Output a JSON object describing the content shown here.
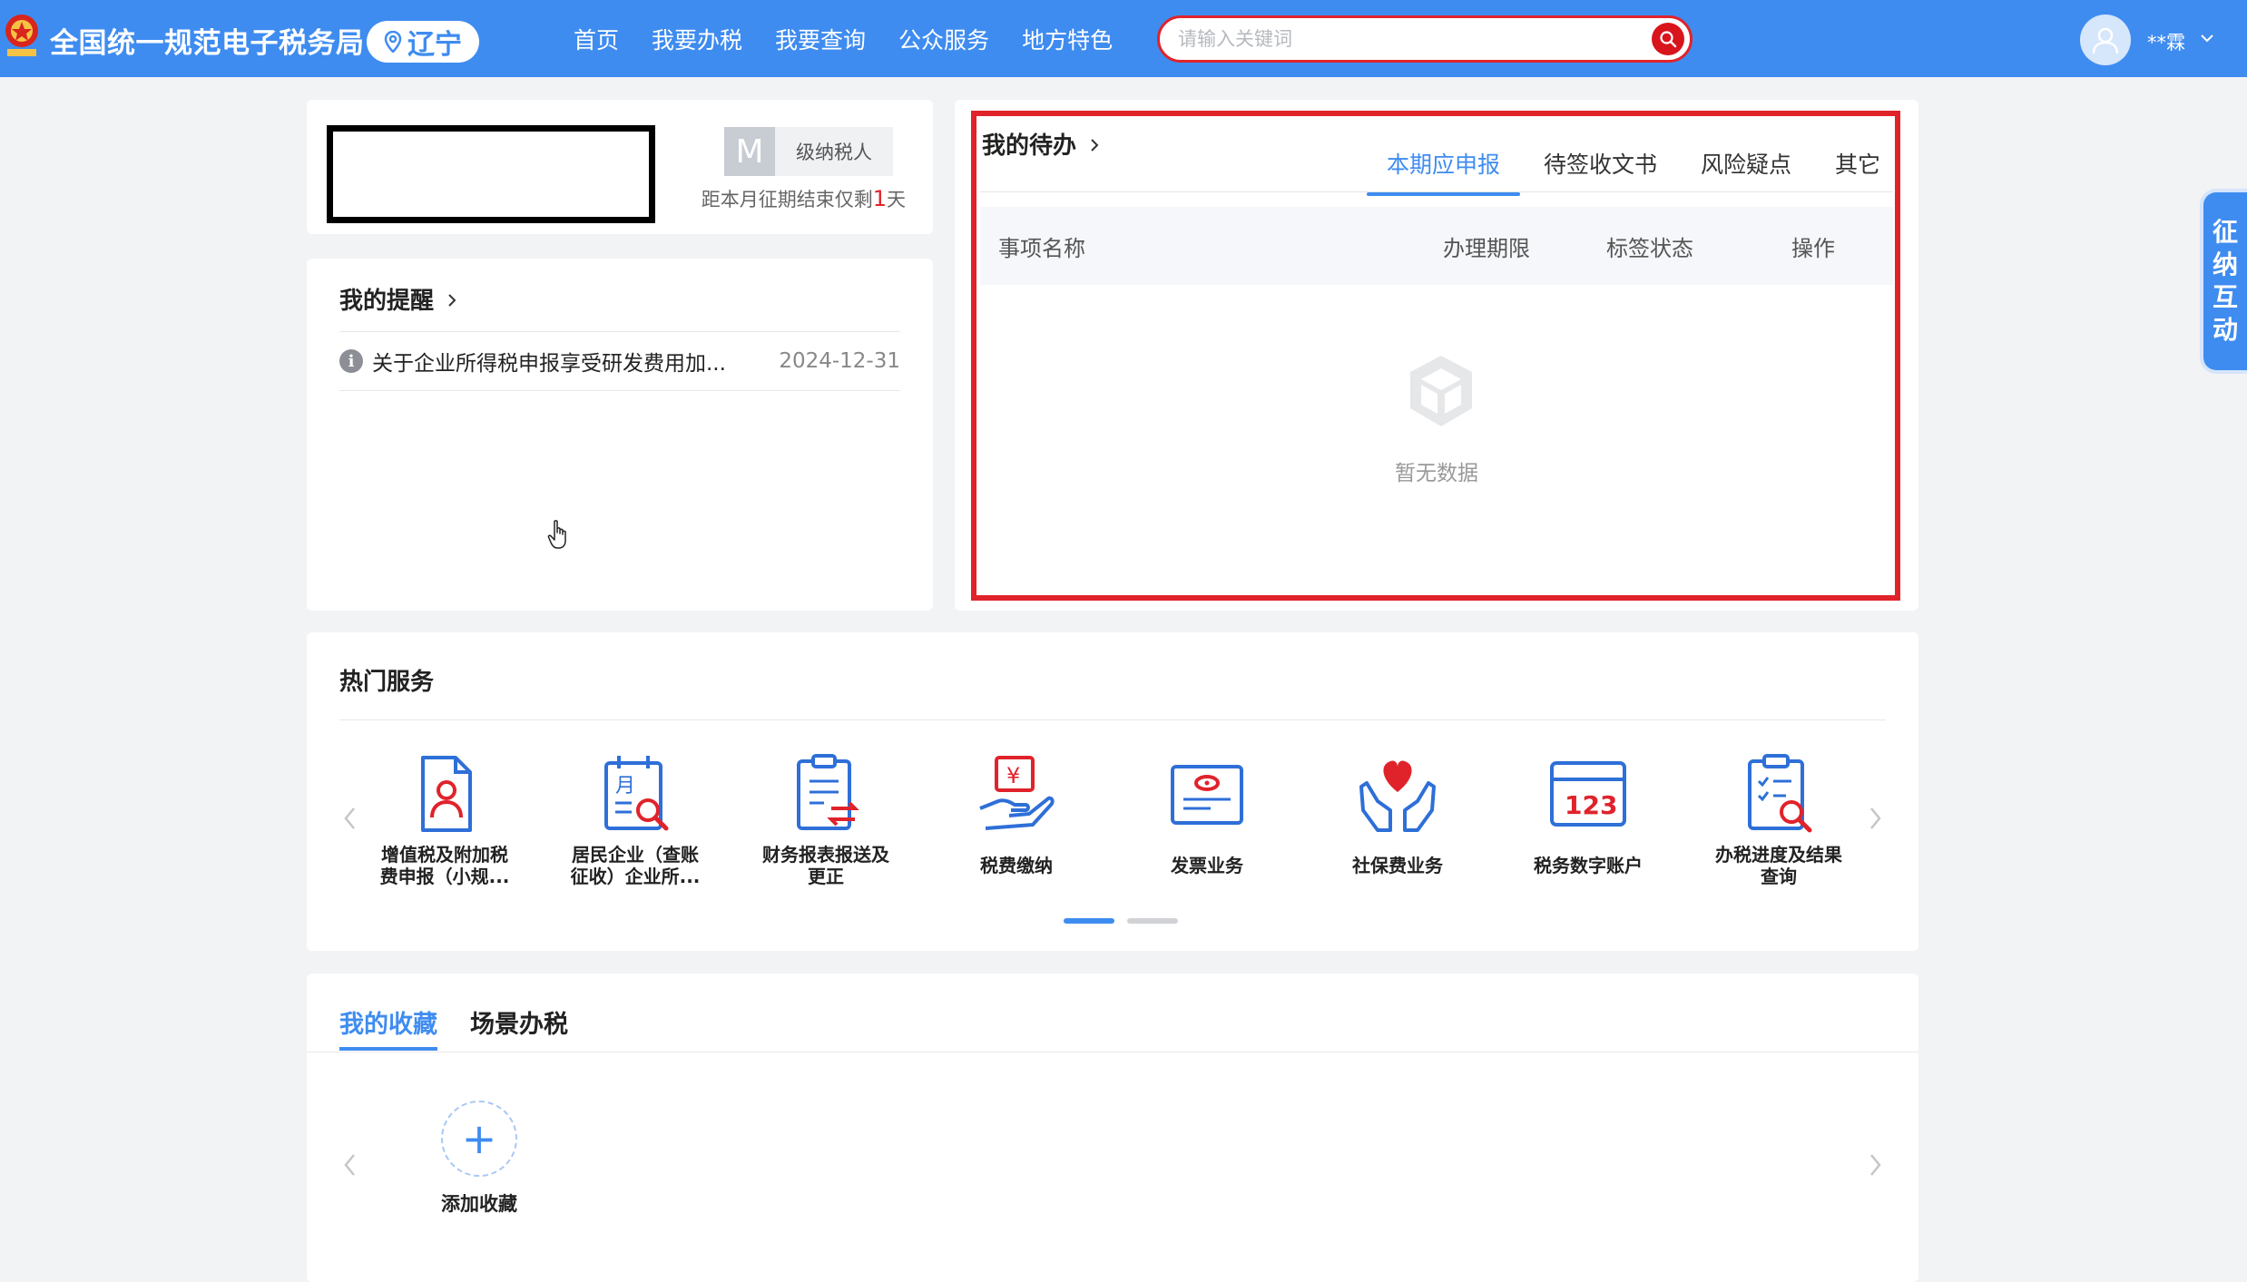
{
  "header": {
    "site_title": "全国统一规范电子税务局",
    "region": "辽宁",
    "nav": [
      "首页",
      "我要办税",
      "我要查询",
      "公众服务",
      "地方特色"
    ],
    "search_placeholder": "请输入关键词",
    "user_name": "**霖",
    "brand_color": "#3f8cf0",
    "search_accent": "#e0232b"
  },
  "taxpayer": {
    "level_letter": "M",
    "level_label": "级纳税人",
    "deadline_prefix": "距本月征期结束仅剩",
    "deadline_days": "1",
    "deadline_suffix": "天"
  },
  "reminders": {
    "title": "我的提醒",
    "items": [
      {
        "text": "关于企业所得税申报享受研发费用加...",
        "date": "2024-12-31"
      }
    ]
  },
  "todo": {
    "title": "我的待办",
    "tabs": [
      "本期应申报",
      "待签收文书",
      "风险疑点",
      "其它"
    ],
    "active_tab": "本期应申报",
    "columns": [
      "事项名称",
      "办理期限",
      "标签状态",
      "操作"
    ],
    "empty_text": "暂无数据"
  },
  "hot_services": {
    "title": "热门服务",
    "items": [
      {
        "label_line1": "增值税及附加税",
        "label_line2": "费申报（小规...",
        "icon": "vat-declaration-icon"
      },
      {
        "label_line1": "居民企业（查账",
        "label_line2": "征收）企业所...",
        "icon": "calendar-search-icon"
      },
      {
        "label_line1": "财务报表报送及",
        "label_line2": "更正",
        "icon": "financial-report-icon"
      },
      {
        "label_line1": "税费缴纳",
        "label_line2": "",
        "icon": "yuan-hand-icon"
      },
      {
        "label_line1": "发票业务",
        "label_line2": "",
        "icon": "invoice-icon"
      },
      {
        "label_line1": "社保费业务",
        "label_line2": "",
        "icon": "heart-hands-icon"
      },
      {
        "label_line1": "税务数字账户",
        "label_line2": "",
        "icon": "digital-account-icon"
      },
      {
        "label_line1": "办税进度及结果",
        "label_line2": "查询",
        "icon": "progress-search-icon"
      }
    ],
    "page_count": 2,
    "active_page": 1
  },
  "favorites": {
    "tabs": [
      "我的收藏",
      "场景办税"
    ],
    "active_tab": "我的收藏",
    "add_label": "添加收藏"
  },
  "side_float": {
    "chars": [
      "征",
      "纳",
      "互",
      "动"
    ]
  }
}
